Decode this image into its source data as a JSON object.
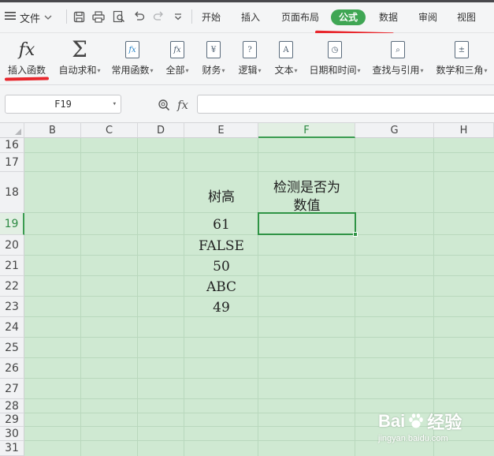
{
  "menubar": {
    "file_label": "文件",
    "tabs": [
      {
        "label": "开始",
        "active": false
      },
      {
        "label": "插入",
        "active": false
      },
      {
        "label": "页面布局",
        "active": false
      },
      {
        "label": "公式",
        "active": true
      },
      {
        "label": "数据",
        "active": false
      },
      {
        "label": "审阅",
        "active": false
      },
      {
        "label": "视图",
        "active": false
      }
    ],
    "quick_access_icons": [
      "save-icon",
      "print-icon",
      "print-preview-icon",
      "undo-icon",
      "redo-icon",
      "customize-dropdown-icon"
    ]
  },
  "ribbon": {
    "buttons": [
      {
        "label": "插入函数",
        "icon": "fx-icon",
        "dropdown": false
      },
      {
        "label": "自动求和",
        "icon": "sigma-icon",
        "dropdown": true
      },
      {
        "label": "常用函数",
        "icon": "common-functions-icon",
        "dropdown": true
      },
      {
        "label": "全部",
        "icon": "all-functions-icon",
        "dropdown": true
      },
      {
        "label": "财务",
        "icon": "finance-icon",
        "dropdown": true
      },
      {
        "label": "逻辑",
        "icon": "logic-icon",
        "dropdown": true
      },
      {
        "label": "文本",
        "icon": "text-icon",
        "dropdown": true
      },
      {
        "label": "日期和时间",
        "icon": "date-time-icon",
        "dropdown": true
      },
      {
        "label": "查找与引用",
        "icon": "lookup-icon",
        "dropdown": true
      },
      {
        "label": "数学和三角",
        "icon": "math-icon",
        "dropdown": true
      }
    ]
  },
  "formula_bar": {
    "name_box": "F19",
    "fx_label": "fx",
    "formula": ""
  },
  "sheet": {
    "columns": [
      "B",
      "C",
      "D",
      "E",
      "F",
      "G",
      "H"
    ],
    "selected_column": "F",
    "rows": [
      "16",
      "17",
      "18",
      "19",
      "20",
      "21",
      "22",
      "23",
      "24",
      "25",
      "26",
      "27",
      "28",
      "29",
      "30",
      "31"
    ],
    "selected_row": "19",
    "active_cell": "F19",
    "cells": {
      "E18": "树高",
      "F18_line1": "检测是否为",
      "F18_line2": "数值",
      "E19": "61",
      "E20": "FALSE",
      "E21": "50",
      "E22": "ABC",
      "E23": "49"
    },
    "colors": {
      "cell_fill": "#cfe9d2",
      "active": "#2f9445",
      "accent_tab": "#3fa654",
      "annotation": "#e8272d"
    }
  },
  "watermark": {
    "brand_left": "Bai",
    "brand_right": "经验",
    "url": "jingyan.baidu.com"
  }
}
